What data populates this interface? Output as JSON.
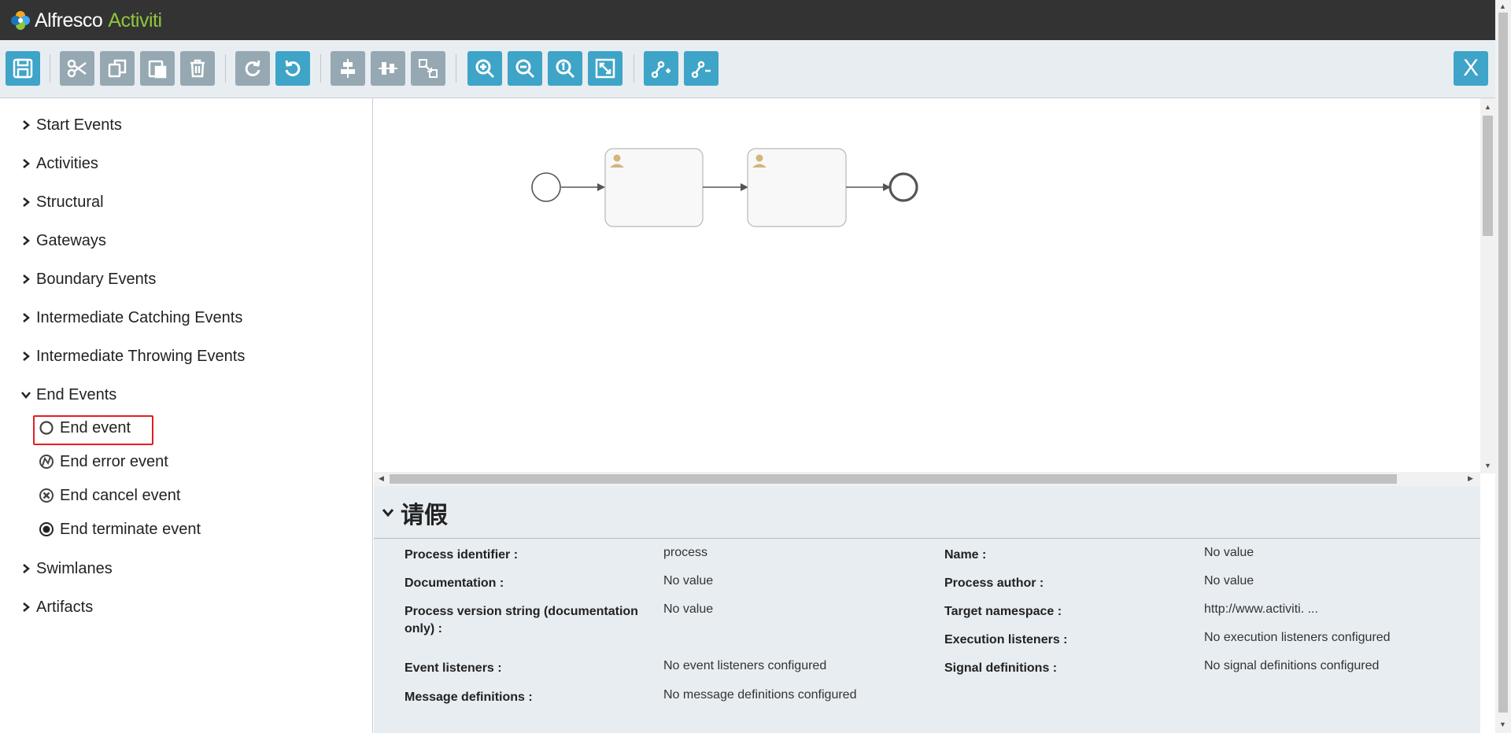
{
  "app": {
    "logo_brand": "Alfresco",
    "logo_product": "Activiti"
  },
  "toolbar": {
    "buttons": [
      {
        "name": "save-button",
        "icon": "floppy-disk-icon"
      },
      {
        "name": "cut-button",
        "icon": "scissors-icon"
      },
      {
        "name": "copy-button",
        "icon": "copy-icon"
      },
      {
        "name": "paste-button",
        "icon": "paste-icon"
      },
      {
        "name": "delete-button",
        "icon": "trash-icon"
      },
      {
        "name": "redo-button",
        "icon": "redo-icon"
      },
      {
        "name": "undo-button",
        "icon": "undo-icon"
      },
      {
        "name": "align-horizontal-button",
        "icon": "align-horizontal-icon"
      },
      {
        "name": "align-vertical-button",
        "icon": "align-vertical-icon"
      },
      {
        "name": "same-size-button",
        "icon": "same-size-icon"
      },
      {
        "name": "zoom-in-button",
        "icon": "zoom-in-icon"
      },
      {
        "name": "zoom-out-button",
        "icon": "zoom-out-icon"
      },
      {
        "name": "zoom-actual-button",
        "icon": "zoom-actual-icon"
      },
      {
        "name": "zoom-fit-button",
        "icon": "fit-screen-icon"
      },
      {
        "name": "add-bendpoint-button",
        "icon": "add-bendpoint-icon"
      },
      {
        "name": "remove-bendpoint-button",
        "icon": "remove-bendpoint-icon"
      }
    ],
    "close_label": "X"
  },
  "palette": {
    "groups": [
      {
        "label": "Start Events",
        "expanded": false
      },
      {
        "label": "Activities",
        "expanded": false
      },
      {
        "label": "Structural",
        "expanded": false
      },
      {
        "label": "Gateways",
        "expanded": false
      },
      {
        "label": "Boundary Events",
        "expanded": false
      },
      {
        "label": "Intermediate Catching Events",
        "expanded": false
      },
      {
        "label": "Intermediate Throwing Events",
        "expanded": false
      },
      {
        "label": "End Events",
        "expanded": true
      },
      {
        "label": "Swimlanes",
        "expanded": false
      },
      {
        "label": "Artifacts",
        "expanded": false
      }
    ],
    "end_event_items": [
      {
        "label": "End event",
        "icon": "end-event-icon",
        "selected": true
      },
      {
        "label": "End error event",
        "icon": "end-error-event-icon"
      },
      {
        "label": "End cancel event",
        "icon": "end-cancel-event-icon"
      },
      {
        "label": "End terminate event",
        "icon": "end-terminate-event-icon"
      }
    ],
    "highlight_color": "#e31e24"
  },
  "diagram": {
    "elements": [
      {
        "type": "start-event"
      },
      {
        "type": "user-task",
        "icon": "user-icon"
      },
      {
        "type": "user-task",
        "icon": "user-icon"
      },
      {
        "type": "end-event"
      }
    ]
  },
  "properties": {
    "process_name": "请假",
    "fields": [
      {
        "label": "Process identifier :",
        "value": "process"
      },
      {
        "label": "Name :",
        "value": "No value"
      },
      {
        "label": "Documentation :",
        "value": "No value"
      },
      {
        "label": "Process author :",
        "value": "No value"
      },
      {
        "label": "Process version string (documentation only) :",
        "value": "No value"
      },
      {
        "label": "Target namespace :",
        "value": "http://www.activiti. ..."
      },
      {
        "label": "Execution listeners :",
        "value": "No execution listeners configured"
      },
      {
        "label": "Event listeners :",
        "value": "No event listeners configured"
      },
      {
        "label": "Signal definitions :",
        "value": "No signal definitions configured"
      },
      {
        "label": "Message definitions :",
        "value": "No message definitions configured"
      }
    ]
  },
  "colors": {
    "header_bg": "#333333",
    "toolbar_bg": "#e8edf1",
    "button_active": "#3ea4c8",
    "button_disabled": "#96a8b1",
    "brand_green": "#8fc53d"
  }
}
